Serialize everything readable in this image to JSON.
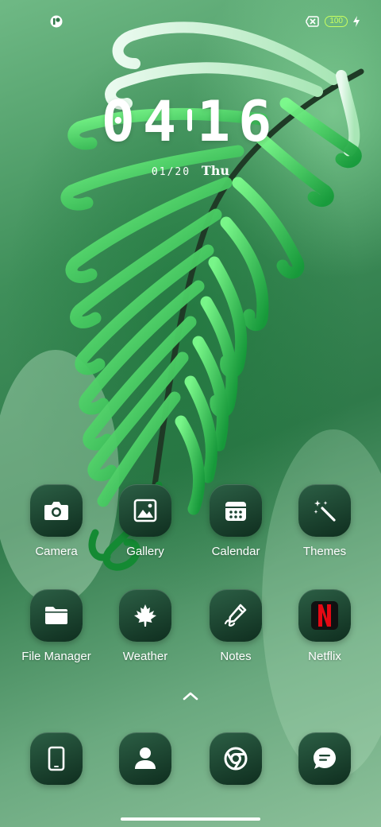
{
  "status_bar": {
    "left_icon": "notification-badge-icon",
    "sim_icon": "no-sim-icon",
    "battery_level": "100",
    "charging_icon": "bolt-icon",
    "battery_color": "#c8ff60"
  },
  "lockclock": {
    "hours": "04",
    "minutes": "16",
    "date": "01/20",
    "day": "Thu"
  },
  "apps": [
    {
      "label": "Camera",
      "icon": "camera-icon"
    },
    {
      "label": "Gallery",
      "icon": "gallery-icon"
    },
    {
      "label": "Calendar",
      "icon": "calendar-icon"
    },
    {
      "label": "Themes",
      "icon": "magic-wand-icon"
    },
    {
      "label": "File Manager",
      "icon": "folder-icon"
    },
    {
      "label": "Weather",
      "icon": "maple-leaf-icon"
    },
    {
      "label": "Notes",
      "icon": "pen-icon"
    },
    {
      "label": "Netflix",
      "icon": "netflix-icon"
    }
  ],
  "dock": [
    {
      "name": "phone",
      "icon": "phone-icon"
    },
    {
      "name": "contacts",
      "icon": "person-icon"
    },
    {
      "name": "browser",
      "icon": "chrome-icon"
    },
    {
      "name": "messages",
      "icon": "chat-bubble-icon"
    }
  ],
  "colors": {
    "tile_top": "#2c5f45",
    "tile_bottom": "#0f2e1f",
    "netflix_red": "#e50914"
  }
}
